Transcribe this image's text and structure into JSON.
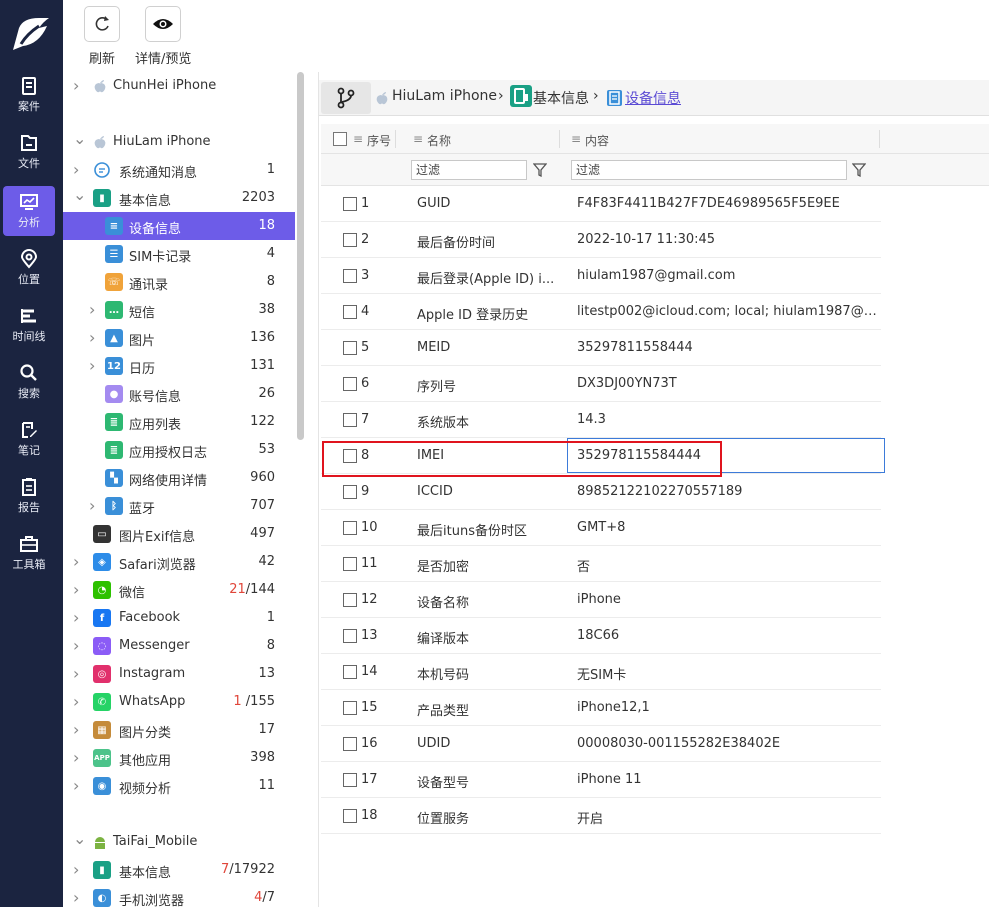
{
  "rail": {
    "items": [
      {
        "label": "案件",
        "icon": "case-icon"
      },
      {
        "label": "文件",
        "icon": "file-icon"
      },
      {
        "label": "分析",
        "icon": "analysis-icon"
      },
      {
        "label": "位置",
        "icon": "location-icon"
      },
      {
        "label": "时间线",
        "icon": "timeline-icon"
      },
      {
        "label": "搜索",
        "icon": "search-icon"
      },
      {
        "label": "笔记",
        "icon": "note-icon"
      },
      {
        "label": "报告",
        "icon": "report-icon"
      },
      {
        "label": "工具箱",
        "icon": "toolbox-icon"
      }
    ],
    "active_index": 2
  },
  "toolbar": {
    "refresh_label": "刷新",
    "detail_label": "详情/预览"
  },
  "tree": {
    "rows": [
      {
        "label": "ChunHei iPhone",
        "count": "",
        "selected": false
      },
      {
        "label": "HiuLam iPhone",
        "count": "",
        "selected": false
      },
      {
        "label": "系统通知消息",
        "count": "1",
        "selected": false
      },
      {
        "label": "基本信息",
        "count": "2203",
        "selected": false
      },
      {
        "label": "设备信息",
        "count": "18",
        "selected": true
      },
      {
        "label": "SIM卡记录",
        "count": "4",
        "selected": false
      },
      {
        "label": "通讯录",
        "count": "8",
        "selected": false
      },
      {
        "label": "短信",
        "count": "38",
        "selected": false
      },
      {
        "label": "图片",
        "count": "136",
        "selected": false
      },
      {
        "label": "日历",
        "count": "131",
        "selected": false
      },
      {
        "label": "账号信息",
        "count": "26",
        "selected": false
      },
      {
        "label": "应用列表",
        "count": "122",
        "selected": false
      },
      {
        "label": "应用授权日志",
        "count": "53",
        "selected": false
      },
      {
        "label": "网络使用详情",
        "count": "960",
        "selected": false
      },
      {
        "label": "蓝牙",
        "count": "707",
        "selected": false
      },
      {
        "label": "图片Exif信息",
        "count": "497",
        "selected": false
      },
      {
        "label": "Safari浏览器",
        "count": "42",
        "selected": false
      },
      {
        "label": "微信",
        "count_red": "21",
        "count": "/144",
        "selected": false
      },
      {
        "label": "Facebook",
        "count": "1",
        "selected": false
      },
      {
        "label": "Messenger",
        "count": "8",
        "selected": false
      },
      {
        "label": "Instagram",
        "count": "13",
        "selected": false
      },
      {
        "label": "WhatsApp",
        "count_red": "1",
        "count": " /155",
        "selected": false
      },
      {
        "label": "图片分类",
        "count": "17",
        "selected": false
      },
      {
        "label": "其他应用",
        "count": "398",
        "selected": false
      },
      {
        "label": "视频分析",
        "count": "11",
        "selected": false
      },
      {
        "label": "TaiFai_Mobile",
        "count": "",
        "selected": false
      },
      {
        "label": "基本信息",
        "count_red": "7",
        "count": "/17922",
        "selected": false
      },
      {
        "label": "手机浏览器",
        "count_red": "4",
        "count": "/7",
        "selected": false
      }
    ]
  },
  "breadcrumb": {
    "device": "HiuLam iPhone",
    "sep": "›",
    "category": "基本信息",
    "current": "设备信息"
  },
  "grid": {
    "headers": {
      "index": "序号",
      "name": "名称",
      "content": "内容"
    },
    "filter_placeholder": "过滤",
    "rows": [
      {
        "index": "1",
        "name": "GUID",
        "content": "F4F83F4411B427F7DE46989565F5E9EE"
      },
      {
        "index": "2",
        "name": "最后备份时间",
        "content": "2022-10-17 11:30:45"
      },
      {
        "index": "3",
        "name": "最后登录(Apple ID) i...",
        "content": "hiulam1987@gmail.com"
      },
      {
        "index": "4",
        "name": "Apple ID 登录历史",
        "content": "litestp002@icloud.com; local; hiulam1987@g..."
      },
      {
        "index": "5",
        "name": "MEID",
        "content": "35297811558444"
      },
      {
        "index": "6",
        "name": "序列号",
        "content": "DX3DJ00YN73T"
      },
      {
        "index": "7",
        "name": "系统版本",
        "content": "14.3"
      },
      {
        "index": "8",
        "name": "IMEI",
        "content": "352978115584444"
      },
      {
        "index": "9",
        "name": "ICCID",
        "content": "89852122102270557189"
      },
      {
        "index": "10",
        "name": "最后ituns备份时区",
        "content": "GMT+8"
      },
      {
        "index": "11",
        "name": "是否加密",
        "content": "否"
      },
      {
        "index": "12",
        "name": "设备名称",
        "content": "iPhone"
      },
      {
        "index": "13",
        "name": "编译版本",
        "content": "18C66"
      },
      {
        "index": "14",
        "name": "本机号码",
        "content": "无SIM卡"
      },
      {
        "index": "15",
        "name": "产品类型",
        "content": "iPhone12,1"
      },
      {
        "index": "16",
        "name": "UDID",
        "content": "00008030-001155282E38402E"
      },
      {
        "index": "17",
        "name": "设备型号",
        "content": "iPhone 11"
      },
      {
        "index": "18",
        "name": "位置服务",
        "content": "开启"
      }
    ],
    "selected_row": 8
  },
  "colors": {
    "rail_bg": "#1b2440",
    "accent": "#6d5ce8",
    "highlight_box": "#e0141e",
    "focus_border": "#3d7bd9",
    "count_red": "#e0463a"
  }
}
